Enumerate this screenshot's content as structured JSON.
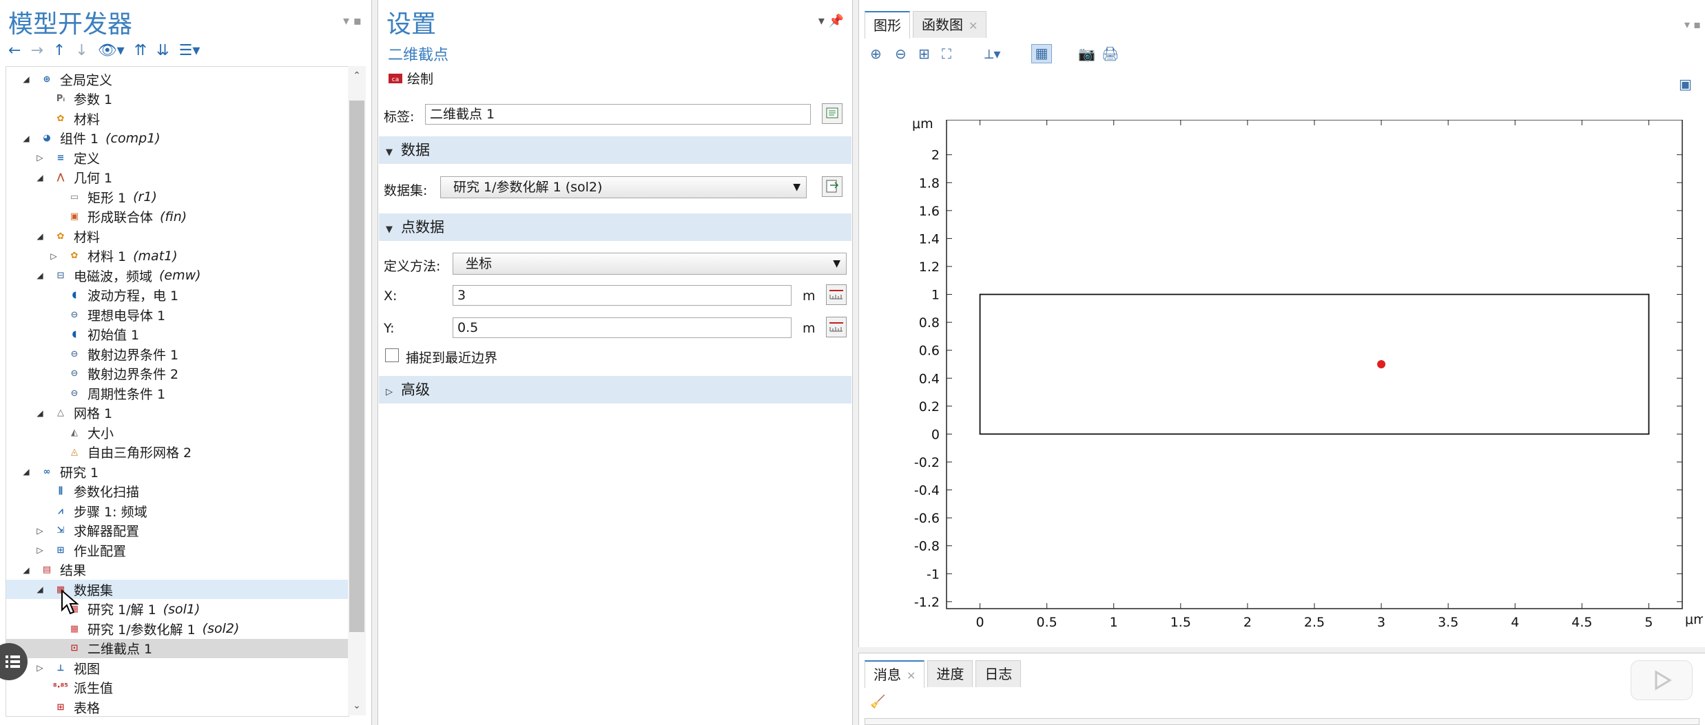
{
  "left_panel": {
    "title": "模型开发器",
    "tree": [
      {
        "label": "全局定义",
        "sub": "",
        "icon": "globe-icon"
      },
      {
        "label": "参数 1",
        "sub": "",
        "icon": "parameter-icon"
      },
      {
        "label": "材料",
        "sub": "",
        "icon": "material-icon"
      },
      {
        "label": "组件 1",
        "sub": "(comp1)",
        "icon": "component-icon"
      },
      {
        "label": "定义",
        "sub": "",
        "icon": "definitions-icon"
      },
      {
        "label": "几何 1",
        "sub": "",
        "icon": "geometry-icon"
      },
      {
        "label": "矩形 1",
        "sub": "(r1)",
        "icon": "rectangle-icon"
      },
      {
        "label": "形成联合体",
        "sub": "(fin)",
        "icon": "form-union-icon"
      },
      {
        "label": "材料",
        "sub": "",
        "icon": "material-icon"
      },
      {
        "label": "材料 1",
        "sub": "(mat1)",
        "icon": "material-icon"
      },
      {
        "label": "电磁波，频域",
        "sub": "(emw)",
        "icon": "physics-icon"
      },
      {
        "label": "波动方程，电 1",
        "sub": "",
        "icon": "domain-feature-icon"
      },
      {
        "label": "理想电导体 1",
        "sub": "",
        "icon": "boundary-feature-icon"
      },
      {
        "label": "初始值 1",
        "sub": "",
        "icon": "domain-feature-icon"
      },
      {
        "label": "散射边界条件 1",
        "sub": "",
        "icon": "boundary-feature-icon"
      },
      {
        "label": "散射边界条件 2",
        "sub": "",
        "icon": "boundary-feature-icon"
      },
      {
        "label": "周期性条件 1",
        "sub": "",
        "icon": "boundary-feature-icon"
      },
      {
        "label": "网格 1",
        "sub": "",
        "icon": "mesh-icon"
      },
      {
        "label": "大小",
        "sub": "",
        "icon": "mesh-size-icon"
      },
      {
        "label": "自由三角形网格 2",
        "sub": "",
        "icon": "free-triangular-icon"
      },
      {
        "label": "研究 1",
        "sub": "",
        "icon": "study-icon"
      },
      {
        "label": "参数化扫描",
        "sub": "",
        "icon": "parametric-sweep-icon"
      },
      {
        "label": "步骤 1: 频域",
        "sub": "",
        "icon": "frequency-domain-icon"
      },
      {
        "label": "求解器配置",
        "sub": "",
        "icon": "solver-configurations-icon"
      },
      {
        "label": "作业配置",
        "sub": "",
        "icon": "job-configurations-icon"
      },
      {
        "label": "结果",
        "sub": "",
        "icon": "results-icon"
      },
      {
        "label": "数据集",
        "sub": "",
        "icon": "datasets-icon"
      },
      {
        "label": "研究 1/解 1",
        "sub": "(sol1)",
        "icon": "solution-dataset-icon"
      },
      {
        "label": "研究 1/参数化解 1",
        "sub": "(sol2)",
        "icon": "solution-dataset-icon"
      },
      {
        "label": "二维截点 1",
        "sub": "",
        "icon": "cut-point-icon"
      },
      {
        "label": "视图",
        "sub": "",
        "icon": "views-icon"
      },
      {
        "label": "派生值",
        "sub": "",
        "icon": "derived-values-icon"
      },
      {
        "label": "表格",
        "sub": "",
        "icon": "tables-icon"
      }
    ]
  },
  "settings": {
    "title": "设置",
    "subtitle": "二维截点",
    "plot_button": "绘制",
    "label_caption": "标签:",
    "label_value": "二维截点 1",
    "section_data": "数据",
    "dataset_caption": "数据集:",
    "dataset_value": "研究 1/参数化解 1 (sol2)",
    "section_point_data": "点数据",
    "method_caption": "定义方法:",
    "method_value": "坐标",
    "x_caption": "X:",
    "x_value": "3",
    "x_unit": "m",
    "y_caption": "Y:",
    "y_value": "0.5",
    "y_unit": "m",
    "snap_label": "捕捉到最近边界",
    "snap_checked": false,
    "section_advanced": "高级"
  },
  "graphics": {
    "tabs": [
      {
        "label": "图形",
        "closable": false
      },
      {
        "label": "函数图",
        "closable": true
      }
    ]
  },
  "chart_data": {
    "type": "scatter",
    "xlabel": "μm",
    "ylabel": "μm",
    "xlim": [
      -0.25,
      5.25
    ],
    "ylim": [
      -1.25,
      2.25
    ],
    "x_ticks": [
      "0",
      "0.5",
      "1",
      "1.5",
      "2",
      "2.5",
      "3",
      "3.5",
      "4",
      "4.5",
      "5"
    ],
    "y_ticks": [
      "2",
      "1.8",
      "1.6",
      "1.4",
      "1.2",
      "1",
      "0.8",
      "0.6",
      "0.4",
      "0.2",
      "0",
      "-0.2",
      "-0.4",
      "-0.6",
      "-0.8",
      "-1",
      "-1.2"
    ],
    "shapes": [
      {
        "type": "rectangle",
        "x": [
          0,
          5
        ],
        "y": [
          0,
          1
        ]
      }
    ],
    "points": [
      {
        "x": 3,
        "y": 0.5,
        "color": "#e02020"
      }
    ]
  },
  "messages": {
    "tabs": [
      {
        "label": "消息",
        "closable": true
      },
      {
        "label": "进度",
        "closable": false
      },
      {
        "label": "日志",
        "closable": false
      }
    ]
  }
}
